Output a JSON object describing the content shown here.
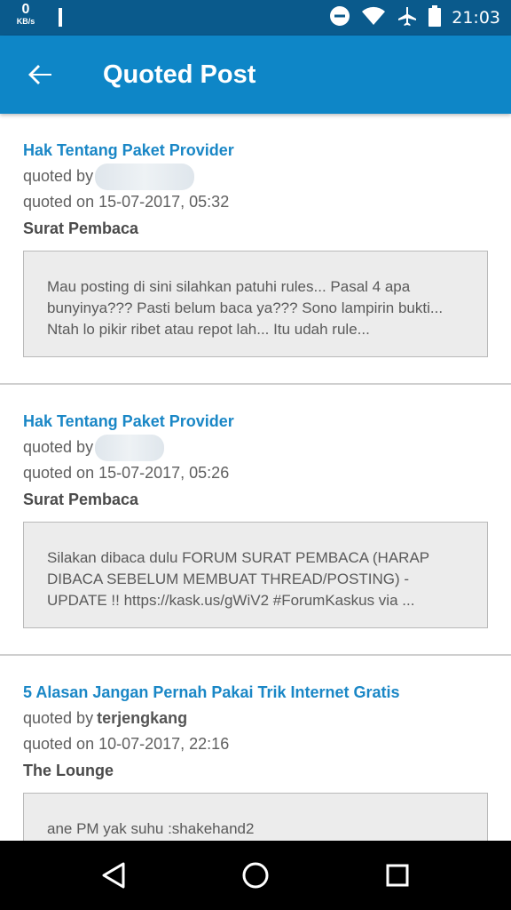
{
  "status_bar": {
    "net_speed": "0",
    "net_unit": "KB/s",
    "time": "21:03",
    "icons": [
      "dnd-icon",
      "wifi-icon",
      "airplane-icon",
      "battery-icon"
    ]
  },
  "app_bar": {
    "title": "Quoted Post",
    "back_icon": "arrow-left-icon",
    "color": "#0e86c7"
  },
  "posts": [
    {
      "title": "Hak Tentang Paket Provider",
      "quoted_by_label": "quoted by",
      "quoted_by_user": "",
      "quoted_on": "quoted on 15-07-2017, 05:32",
      "forum": "Surat Pembaca",
      "excerpt": "Mau posting di sini silahkan patuhi rules... Pasal 4 apa bunyinya??? Pasti belum baca ya??? Sono lampirin bukti... Ntah lo pikir ribet atau repot lah... Itu udah rule..."
    },
    {
      "title": "Hak Tentang Paket Provider",
      "quoted_by_label": "quoted by",
      "quoted_by_user": "",
      "quoted_on": "quoted on 15-07-2017, 05:26",
      "forum": "Surat Pembaca",
      "excerpt": "Silakan dibaca dulu FORUM SURAT PEMBACA (HARAP DIBACA SEBELUM MEMBUAT THREAD/POSTING) - UPDATE !! https://kask.us/gWiV2 #ForumKaskus via ..."
    },
    {
      "title": "5 Alasan Jangan Pernah Pakai Trik Internet Gratis",
      "quoted_by_label": "quoted by",
      "quoted_by_user": "terjengkang",
      "quoted_on": "quoted on 10-07-2017, 22:16",
      "forum": "The Lounge",
      "excerpt": "ane PM yak suhu :shakehand2"
    }
  ],
  "nav_bar": {
    "icons": [
      "back-triangle-icon",
      "home-circle-icon",
      "recents-square-icon"
    ]
  }
}
